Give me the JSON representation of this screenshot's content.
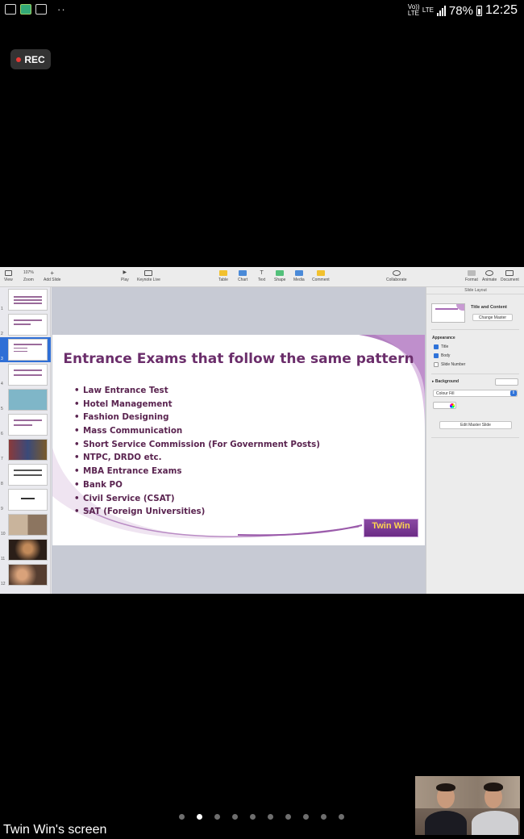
{
  "status_bar": {
    "dots": "··",
    "volte": "Vo))\nLTE",
    "lte": "LTE",
    "battery": "78%",
    "time": "12:25"
  },
  "recording": {
    "label": "REC"
  },
  "keynote": {
    "toolbar": [
      {
        "label": "View",
        "icon": "view-icon"
      },
      {
        "label": "Zoom",
        "value": "107%",
        "icon": "zoom-icon"
      },
      {
        "label": "Add Slide",
        "icon": "add-icon"
      },
      {
        "label": "Play",
        "icon": "play-icon"
      },
      {
        "label": "Keynote Live",
        "icon": "keynote-live-icon"
      },
      {
        "label": "Table",
        "icon": "table-icon"
      },
      {
        "label": "Chart",
        "icon": "chart-icon"
      },
      {
        "label": "Text",
        "icon": "text-icon"
      },
      {
        "label": "Shape",
        "icon": "shape-icon"
      },
      {
        "label": "Media",
        "icon": "media-icon"
      },
      {
        "label": "Comment",
        "icon": "comment-icon"
      },
      {
        "label": "Collaborate",
        "icon": "collaborate-icon"
      },
      {
        "label": "Format",
        "icon": "format-icon"
      },
      {
        "label": "Animate",
        "icon": "animate-icon"
      },
      {
        "label": "Document",
        "icon": "document-icon"
      }
    ],
    "slide_numbers": [
      "1",
      "2",
      "3",
      "4",
      "5",
      "6",
      "7",
      "8",
      "9",
      "10",
      "11",
      "12"
    ],
    "selected_slide": 3,
    "slide": {
      "title": "Entrance Exams that follow the same pattern",
      "bullets": [
        "Law Entrance Test",
        "Hotel Management",
        "Fashion Designing",
        "Mass Communication",
        "Short Service Commission (For Government Posts)",
        "NTPC, DRDO etc.",
        "MBA Entrance Exams",
        "Bank PO",
        "Civil Service (CSAT)",
        "SAT (Foreign Universities)"
      ],
      "logo": "Twin Win"
    },
    "inspector": {
      "tab": "Slide Layout",
      "layout_name": "Title and Content",
      "change_master": "Change Master",
      "appearance": "Appearance",
      "checkboxes": [
        {
          "label": "Title",
          "checked": true
        },
        {
          "label": "Body",
          "checked": true
        },
        {
          "label": "Slide Number",
          "checked": false
        }
      ],
      "background": "Background",
      "fill": "Colour Fill",
      "edit_master": "Edit Master Slide"
    }
  },
  "pager": {
    "count": 10,
    "active": 1
  },
  "screen_label": "Twin Win's screen",
  "colors": {
    "accent": "#2f6fd6",
    "slide_title": "#6b2e6b",
    "bullet": "#5a2450",
    "slide_swoosh": "#a56ab5"
  }
}
